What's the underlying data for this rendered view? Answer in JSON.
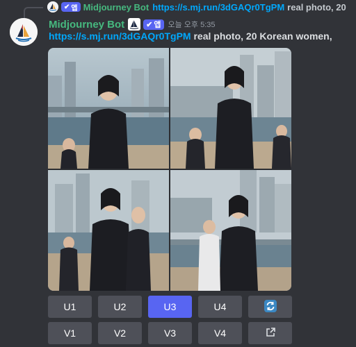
{
  "reply": {
    "badge_label": "앱",
    "author": "Midjourney Bot",
    "link": "https://s.mj.run/3dGAQr0TgPM",
    "text": "real photo, 20"
  },
  "message": {
    "author": "Midjourney Bot",
    "badge_label": "앱",
    "timestamp": "오늘 오후 5:35",
    "link": "https://s.mj.run/3dGAQr0TgPM",
    "text": "real photo, 20 Korean women,"
  },
  "buttons": {
    "row1": [
      "U1",
      "U2",
      "U3",
      "U4"
    ],
    "row2": [
      "V1",
      "V2",
      "V3",
      "V4"
    ],
    "active": "U3",
    "reroll_icon": "refresh-icon",
    "open_icon": "external-link-icon"
  },
  "colors": {
    "background": "#313338",
    "bot_name": "#46b97f",
    "link": "#00a8fc",
    "badge": "#5865f2",
    "button": "#4e5058",
    "button_active": "#5865f2"
  }
}
